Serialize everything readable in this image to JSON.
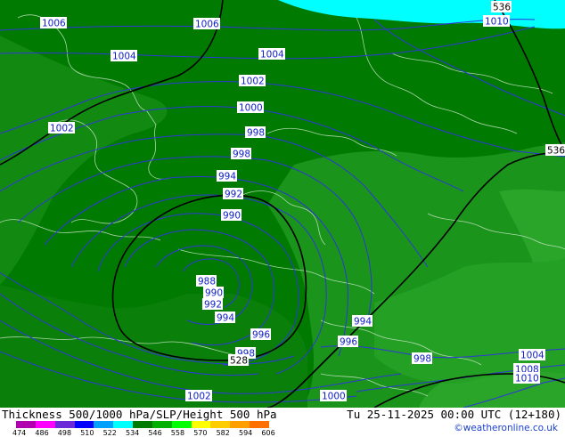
{
  "map": {
    "isobar_labels": [
      "1006",
      "1006",
      "1004",
      "1004",
      "1002",
      "1002",
      "1000",
      "998",
      "998",
      "994",
      "992",
      "990",
      "988",
      "990",
      "992",
      "994",
      "996",
      "998",
      "994",
      "996",
      "998",
      "1000",
      "1002",
      "1004",
      "1008",
      "1010",
      "1010"
    ],
    "thickness_labels": [
      "536",
      "536",
      "528"
    ],
    "colors": {
      "water": "#00ffff",
      "dark_green": "#007a00",
      "mid_green": "#169016",
      "light_green": "#33b233",
      "isobar": "#2e38d8",
      "thickness_line": "#000000",
      "border": "#c8e6c8"
    }
  },
  "footer": {
    "title": "Thickness 500/1000 hPa/SLP/Height 500 hPa",
    "datetime": "Tu 25-11-2025 00:00 UTC (12+180)",
    "credit": "©weatheronline.co.uk",
    "colorbar_ticks": [
      "474",
      "486",
      "498",
      "510",
      "522",
      "534",
      "546",
      "558",
      "570",
      "582",
      "594",
      "606"
    ],
    "colorbar_colors": [
      "#b000b0",
      "#ff00ff",
      "#6a2ad8",
      "#0000ff",
      "#00a0ff",
      "#00ffff",
      "#007a00",
      "#00b000",
      "#00ff00",
      "#ffff00",
      "#ffcc00",
      "#ffa000",
      "#ff7000"
    ]
  }
}
